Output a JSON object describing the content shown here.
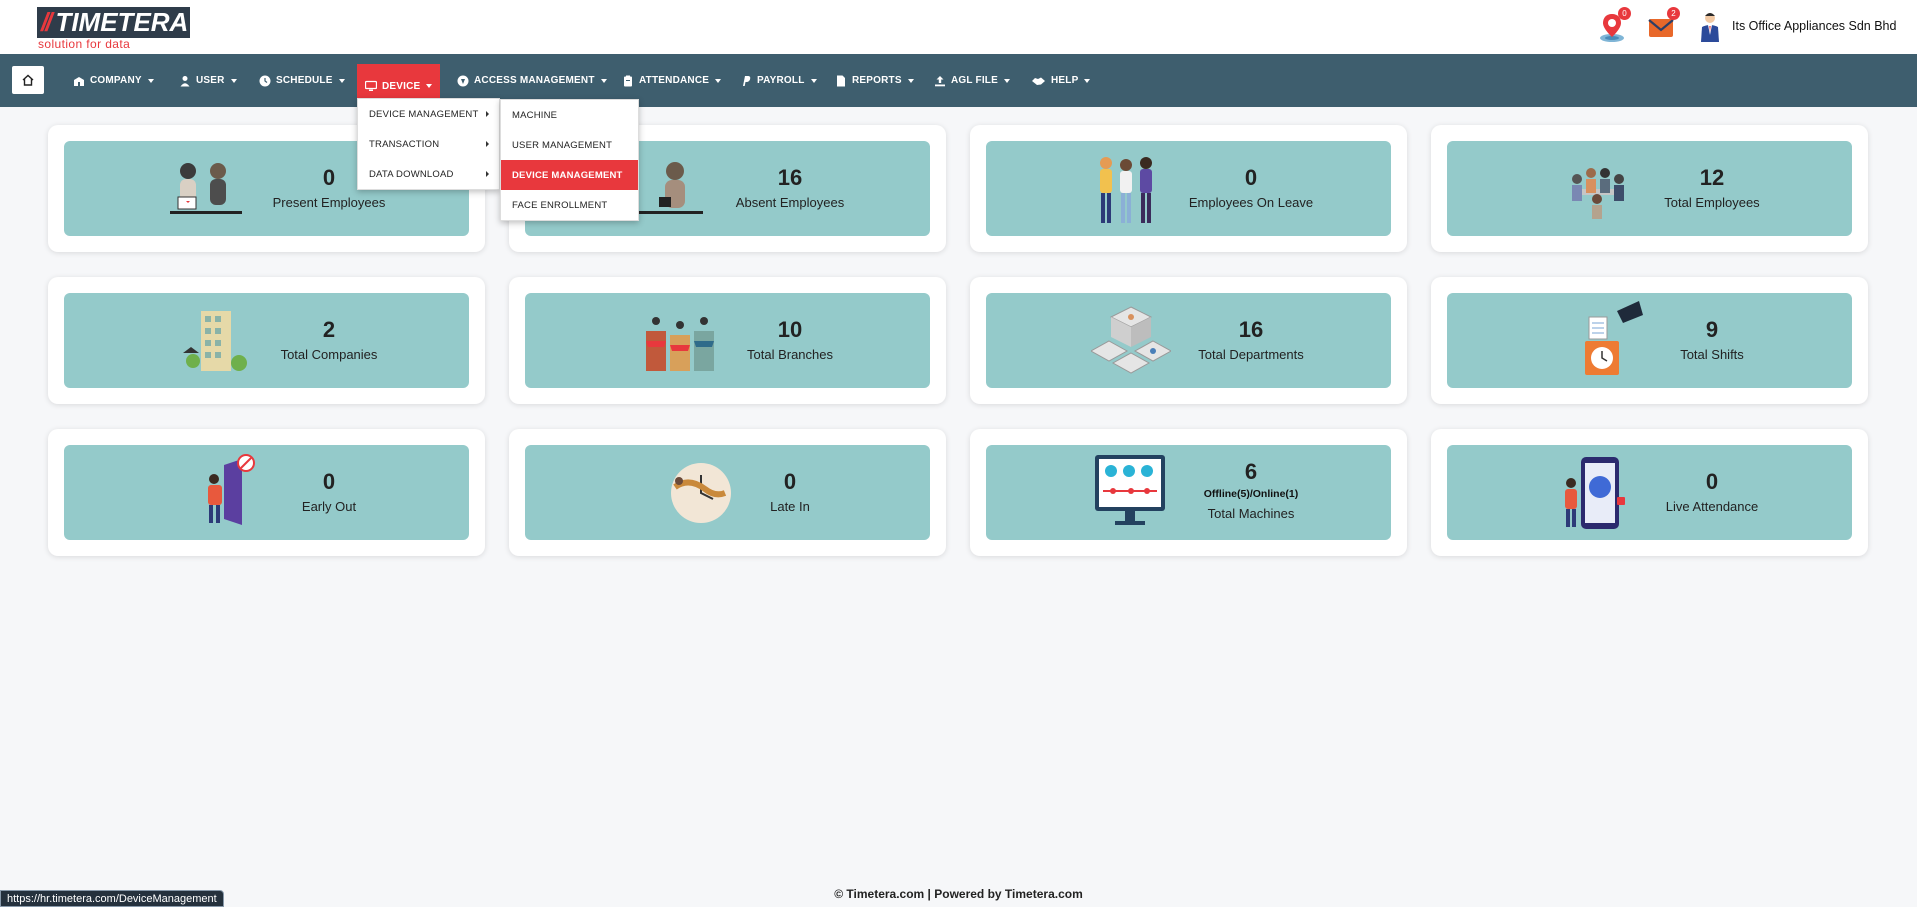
{
  "brand": {
    "name": "TIMETERA",
    "slashes": "//",
    "tagline": "solution for data"
  },
  "header": {
    "location_badge": "0",
    "mail_badge": "2",
    "company_name": "Its Office Appliances Sdn Bhd",
    "icons": [
      "map-pin-icon",
      "mail-icon",
      "user-avatar-icon"
    ]
  },
  "nav": {
    "items": [
      {
        "label": "COMPANY",
        "icon": "building-icon"
      },
      {
        "label": "USER",
        "icon": "user-icon"
      },
      {
        "label": "SCHEDULE",
        "icon": "clock-icon"
      },
      {
        "label": "DEVICE",
        "icon": "monitor-icon"
      },
      {
        "label": "ACCESS MANAGEMENT",
        "icon": "access-icon"
      },
      {
        "label": "ATTENDANCE",
        "icon": "clipboard-icon"
      },
      {
        "label": "PAYROLL",
        "icon": "paypal-icon"
      },
      {
        "label": "REPORTS",
        "icon": "file-icon"
      },
      {
        "label": "AGL FILE",
        "icon": "upload-icon"
      },
      {
        "label": "HELP",
        "icon": "handshake-icon"
      }
    ],
    "active": "DEVICE"
  },
  "device_menu": {
    "items": [
      "DEVICE MANAGEMENT",
      "TRANSACTION",
      "DATA DOWNLOAD"
    ]
  },
  "device_submenu": {
    "items": [
      "MACHINE",
      "USER MANAGEMENT",
      "DEVICE MANAGEMENT",
      "FACE ENROLLMENT"
    ],
    "active": "DEVICE MANAGEMENT"
  },
  "cards": [
    {
      "value": "0",
      "label": "Present Employees",
      "icon": "present-employees-illustration"
    },
    {
      "value": "16",
      "label": "Absent Employees",
      "icon": "absent-employees-illustration"
    },
    {
      "value": "0",
      "label": "Employees On Leave",
      "icon": "leave-illustration"
    },
    {
      "value": "12",
      "label": "Total Employees",
      "icon": "team-illustration"
    },
    {
      "value": "2",
      "label": "Total Companies",
      "icon": "building-illustration"
    },
    {
      "value": "10",
      "label": "Total Branches",
      "icon": "branches-illustration"
    },
    {
      "value": "16",
      "label": "Total Departments",
      "icon": "departments-illustration"
    },
    {
      "value": "9",
      "label": "Total Shifts",
      "icon": "shifts-illustration"
    },
    {
      "value": "0",
      "label": "Early Out",
      "icon": "early-out-illustration"
    },
    {
      "value": "0",
      "label": "Late In",
      "icon": "late-in-illustration"
    },
    {
      "value": "6",
      "sub": "Offline(5)/Online(1)",
      "label": "Total Machines",
      "icon": "machines-illustration"
    },
    {
      "value": "0",
      "label": "Live Attendance",
      "icon": "live-attendance-illustration"
    }
  ],
  "footer": {
    "text": "© Timetera.com  |  Powered by Timetera.com"
  },
  "status_url": "https://hr.timetera.com/DeviceManagement",
  "colors": {
    "nav": "#3e5e6e",
    "accent": "#e8383d",
    "card": "#94caca"
  }
}
